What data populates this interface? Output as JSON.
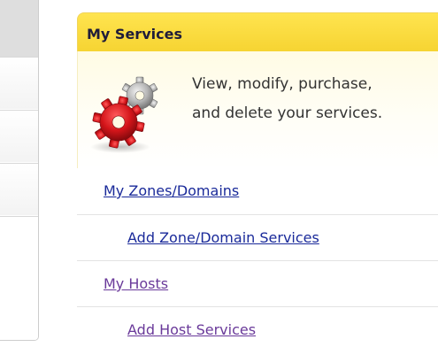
{
  "panel": {
    "title": "My Services",
    "intro_lines": [
      "View, modify, purchase,",
      "and delete your services."
    ],
    "icon": "gears-icon",
    "header_color": "#f9db3a",
    "intro_bg_color": "#fffbe4"
  },
  "links": [
    {
      "label": "My Zones/Domains",
      "level": 1,
      "color": "#1a2a9a"
    },
    {
      "label": "Add Zone/Domain Services",
      "level": 2,
      "color": "#1a2a9a"
    },
    {
      "label": "My Hosts",
      "level": 1,
      "color": "#6a3a9a"
    },
    {
      "label": "Add Host Services",
      "level": 2,
      "color": "#6a3a9a"
    }
  ]
}
